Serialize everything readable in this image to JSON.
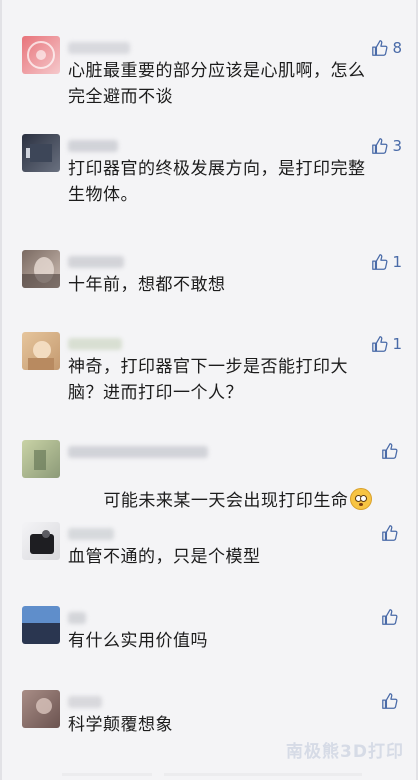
{
  "comments": [
    {
      "text": "心脏最重要的部分应该是心肌啊，怎么完全避而不谈",
      "likes": "8",
      "avatar_colors": [
        "#e8737a",
        "#f5c9cc"
      ],
      "name_color": "#cfd0d6"
    },
    {
      "text": "打印器官的终极发展方向，是打印完整生物体。",
      "likes": "3",
      "avatar_colors": [
        "#2a3040",
        "#6a7180"
      ],
      "name_color": "#c6c8cf"
    },
    {
      "text": "十年前，想都不敢想",
      "likes": "1",
      "avatar_colors": [
        "#7a6a62",
        "#cdbdb3"
      ],
      "name_color": "#c8c9cf"
    },
    {
      "text": "神奇，打印器官下一步是否能打印大脑？进而打印一个人？",
      "likes": "1",
      "avatar_colors": [
        "#e6c59c",
        "#c49a70"
      ],
      "name_color": "#cfd8c6"
    },
    {
      "text": "可能未来某一天会出现打印生命",
      "likes": "",
      "avatar_colors": [
        "#c9d3a6",
        "#8c9a78"
      ],
      "name_color": "#c6c8cf"
    },
    {
      "text": "血管不通的，只是个模型",
      "likes": "",
      "avatar_colors": [
        "#1e1e22",
        "#5c5c62"
      ],
      "name_color": "#cdd0d4"
    },
    {
      "text": "有什么实用价值吗",
      "likes": "",
      "avatar_colors": [
        "#5f8ecb",
        "#2a3650"
      ],
      "name_color": "#c9cbd0"
    },
    {
      "text": "科学颠覆想象",
      "likes": "",
      "avatar_colors": [
        "#a88d86",
        "#6b5350"
      ],
      "name_color": "#cfcfd4"
    }
  ],
  "emoji_name": "flushed-face-emoji",
  "watermark": "南极熊3D打印",
  "colors": {
    "like": "#4a6ba8",
    "background": "#f4f4f6"
  }
}
